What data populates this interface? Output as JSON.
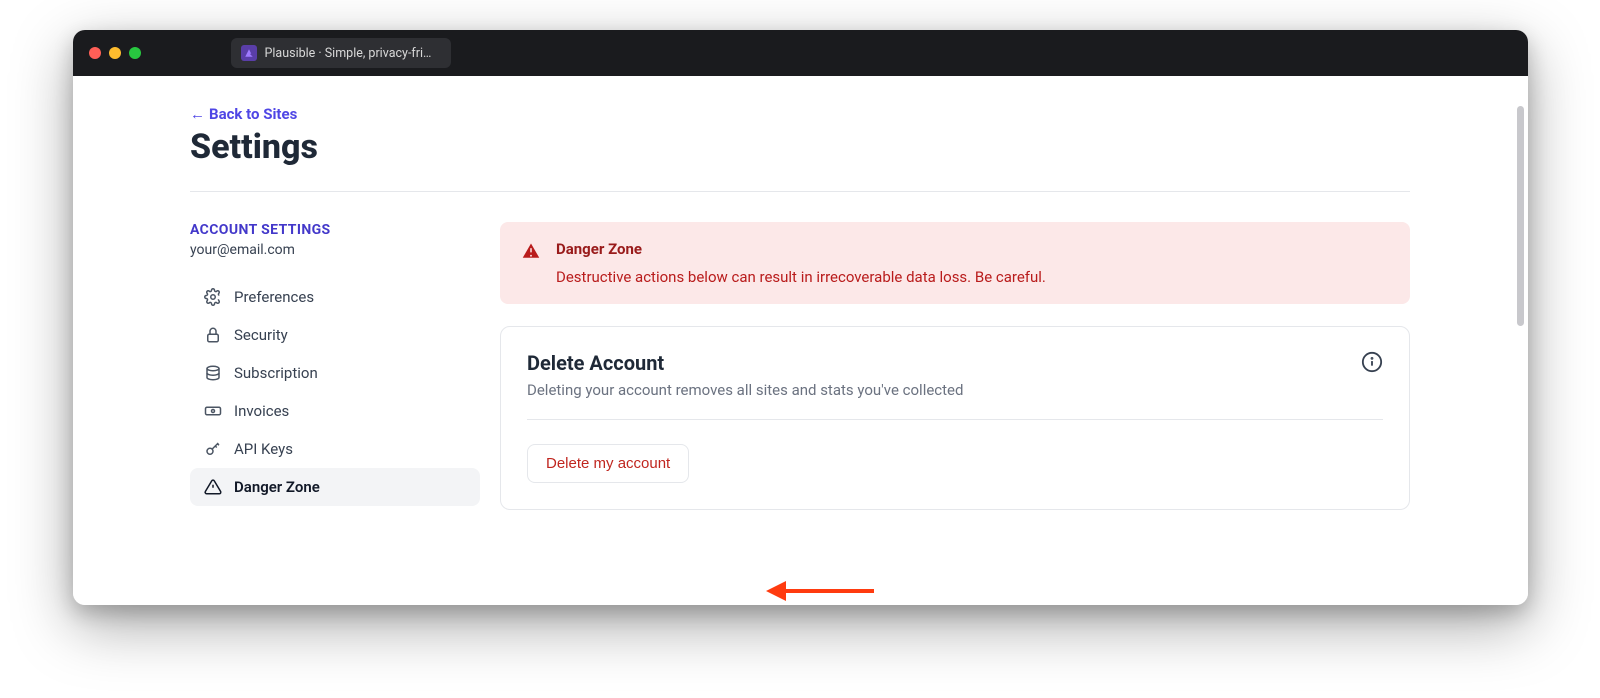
{
  "browser": {
    "tab_title": "Plausible · Simple, privacy-frien"
  },
  "header": {
    "back_link": "Back to Sites",
    "title": "Settings"
  },
  "sidebar": {
    "heading": "ACCOUNT SETTINGS",
    "email": "your@email.com",
    "items": [
      {
        "label": "Preferences",
        "icon": "gear"
      },
      {
        "label": "Security",
        "icon": "lock"
      },
      {
        "label": "Subscription",
        "icon": "stack"
      },
      {
        "label": "Invoices",
        "icon": "banknote"
      },
      {
        "label": "API Keys",
        "icon": "key"
      },
      {
        "label": "Danger Zone",
        "icon": "warning"
      }
    ],
    "active_index": 5
  },
  "alert": {
    "title": "Danger Zone",
    "description": "Destructive actions below can result in irrecoverable data loss. Be careful."
  },
  "card": {
    "title": "Delete Account",
    "description": "Deleting your account removes all sites and stats you've collected",
    "button": "Delete my account"
  },
  "colors": {
    "accent": "#4f46e5",
    "danger": "#b91c1c"
  }
}
